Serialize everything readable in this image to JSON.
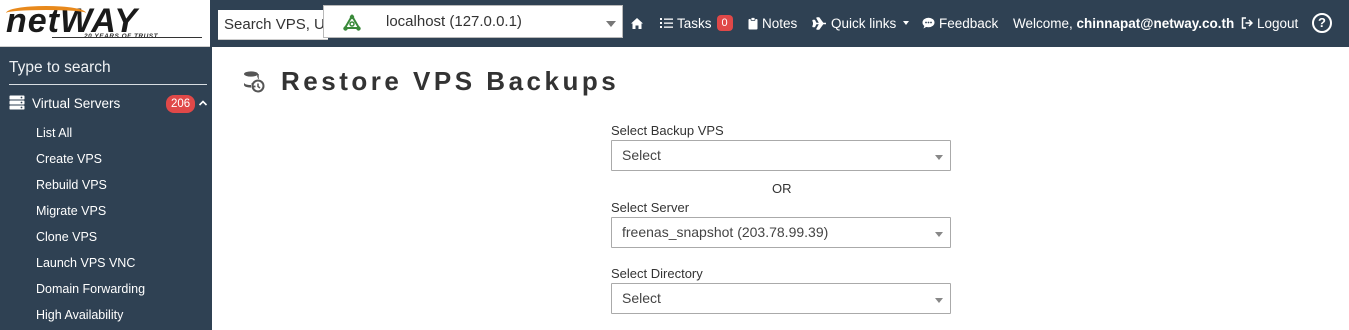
{
  "brand": {
    "logo_text": "netWAY",
    "logo_tagline": "20 YEARS OF TRUST",
    "colors": {
      "topbar": "#2f4153",
      "sidebar": "#2f4153",
      "badge": "#e04848",
      "logo_accent": "#e8891c"
    }
  },
  "topbar": {
    "search_value": "Search VPS, Us",
    "host_select": {
      "icon": "cluster-icon",
      "selected": "localhost (127.0.0.1)"
    },
    "nav": [
      {
        "key": "home",
        "icon": "home-icon",
        "label": ""
      },
      {
        "key": "tasks",
        "icon": "tasks-icon",
        "label": "Tasks",
        "badge": "0"
      },
      {
        "key": "notes",
        "icon": "clipboard-icon",
        "label": "Notes"
      },
      {
        "key": "quick_links",
        "icon": "plane-icon",
        "label": "Quick links"
      },
      {
        "key": "feedback",
        "icon": "comment-icon",
        "label": "Feedback"
      }
    ],
    "welcome_prefix": "Welcome,",
    "welcome_user": "chinnapat@netway.co.th",
    "logout_label": "Logout",
    "help_icon": "help-icon"
  },
  "sidebar": {
    "search_placeholder": "Type to search",
    "section": {
      "icon": "server-icon",
      "label": "Virtual Servers",
      "count": "206"
    },
    "items": [
      {
        "label": "List All"
      },
      {
        "label": "Create VPS"
      },
      {
        "label": "Rebuild VPS"
      },
      {
        "label": "Migrate VPS"
      },
      {
        "label": "Clone VPS"
      },
      {
        "label": "Launch VPS VNC"
      },
      {
        "label": "Domain Forwarding"
      },
      {
        "label": "High Availability"
      }
    ]
  },
  "main": {
    "title": "Restore VPS Backups",
    "title_icon": "database-restore-icon",
    "form": {
      "backup_vps": {
        "label": "Select Backup VPS",
        "value": "Select"
      },
      "or_text": "OR",
      "server": {
        "label": "Select Server",
        "value": "freenas_snapshot (203.78.99.39)"
      },
      "directory": {
        "label": "Select Directory",
        "value": "Select"
      }
    }
  }
}
